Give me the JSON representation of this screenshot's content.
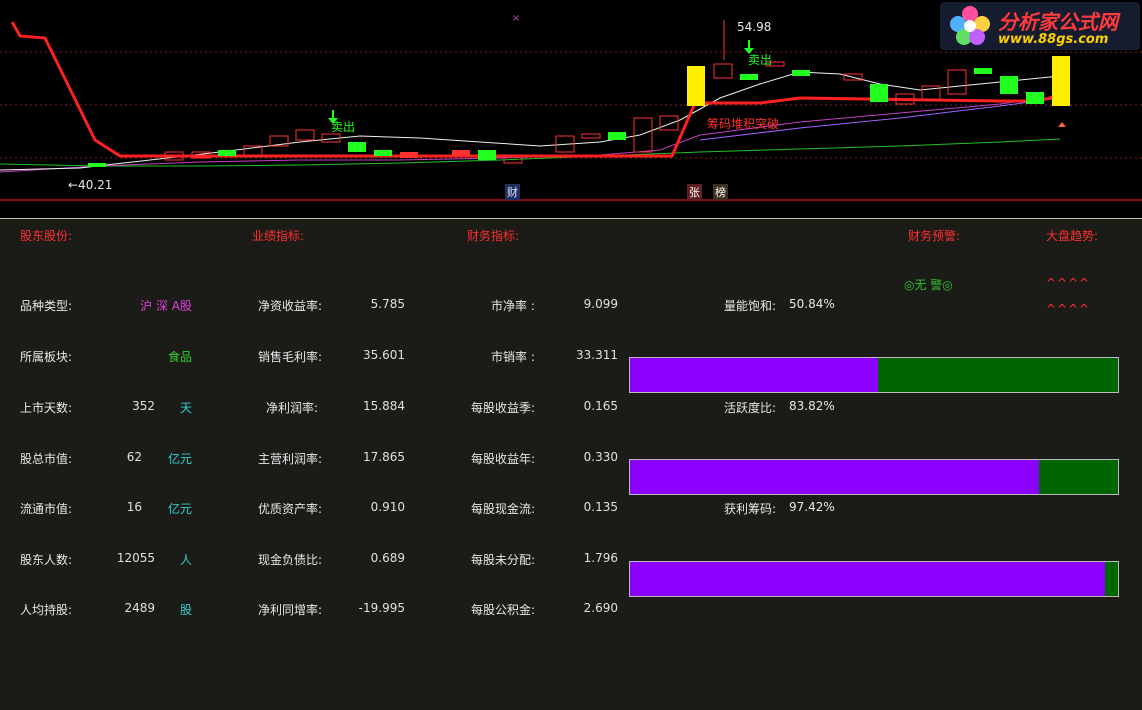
{
  "chart": {
    "high_label": "54.98",
    "low_label": "←40.21",
    "sell_label_1": "卖出",
    "sell_label_2": "卖出",
    "breakout_label": "筹码堆积突破",
    "tag_cai": "财",
    "tag_zhang": "张",
    "tag_bang": "榜"
  },
  "logo": {
    "title": "分析家公式网",
    "url": "www.88gs.com"
  },
  "headers": {
    "shareholders": "股东股份:",
    "performance": "业绩指标:",
    "finance": "财务指标:",
    "warning": "财务预警:",
    "market": "大盘趋势:"
  },
  "warning_value": "◎无 警◎",
  "market_trend": [
    "^^^^",
    "^^^^"
  ],
  "col1": [
    {
      "label": "品种类型:",
      "value": "沪 深 A股",
      "unit": ""
    },
    {
      "label": "所属板块:",
      "value": "食品",
      "unit": ""
    },
    {
      "label": "上市天数:",
      "value": "352",
      "unit": "天"
    },
    {
      "label": "股总市值:",
      "value": "62",
      "unit": "亿元"
    },
    {
      "label": "流通市值:",
      "value": "16",
      "unit": "亿元"
    },
    {
      "label": "股东人数:",
      "value": "12055",
      "unit": "人"
    },
    {
      "label": "人均持股:",
      "value": "2489",
      "unit": "股"
    }
  ],
  "col2": [
    {
      "label": "净资收益率:",
      "value": "5.785"
    },
    {
      "label": "销售毛利率:",
      "value": "35.601"
    },
    {
      "label": "净利润率:",
      "value": "15.884"
    },
    {
      "label": "主营利润率:",
      "value": "17.865"
    },
    {
      "label": "优质资产率:",
      "value": "0.910"
    },
    {
      "label": "现金负债比:",
      "value": "0.689"
    },
    {
      "label": "净利同增率:",
      "value": "-19.995"
    }
  ],
  "col3": [
    {
      "label": "市净率 :",
      "value": "9.099"
    },
    {
      "label": "市销率 :",
      "value": "33.311"
    },
    {
      "label": "每股收益季:",
      "value": "0.165"
    },
    {
      "label": "每股收益年:",
      "value": "0.330"
    },
    {
      "label": "每股现金流:",
      "value": "0.135"
    },
    {
      "label": "每股未分配:",
      "value": "1.796"
    },
    {
      "label": "每股公积金:",
      "value": "2.690"
    }
  ],
  "gauges": [
    {
      "label": "量能饱和:",
      "value_text": "50.84%",
      "fraction": 0.5084
    },
    {
      "label": "活跃度比:",
      "value_text": "83.82%",
      "fraction": 0.8382
    },
    {
      "label": "获利筹码:",
      "value_text": "97.42%",
      "fraction": 0.9742
    }
  ],
  "colors": {
    "header": "#ff3030",
    "bar_fill": "#8b00ff",
    "bar_bg": "#006600",
    "warning": "#30c030",
    "market": "#ff3030",
    "type_value": "#e040e0",
    "sector_value": "#30d030",
    "unit": "#30d0d0"
  }
}
